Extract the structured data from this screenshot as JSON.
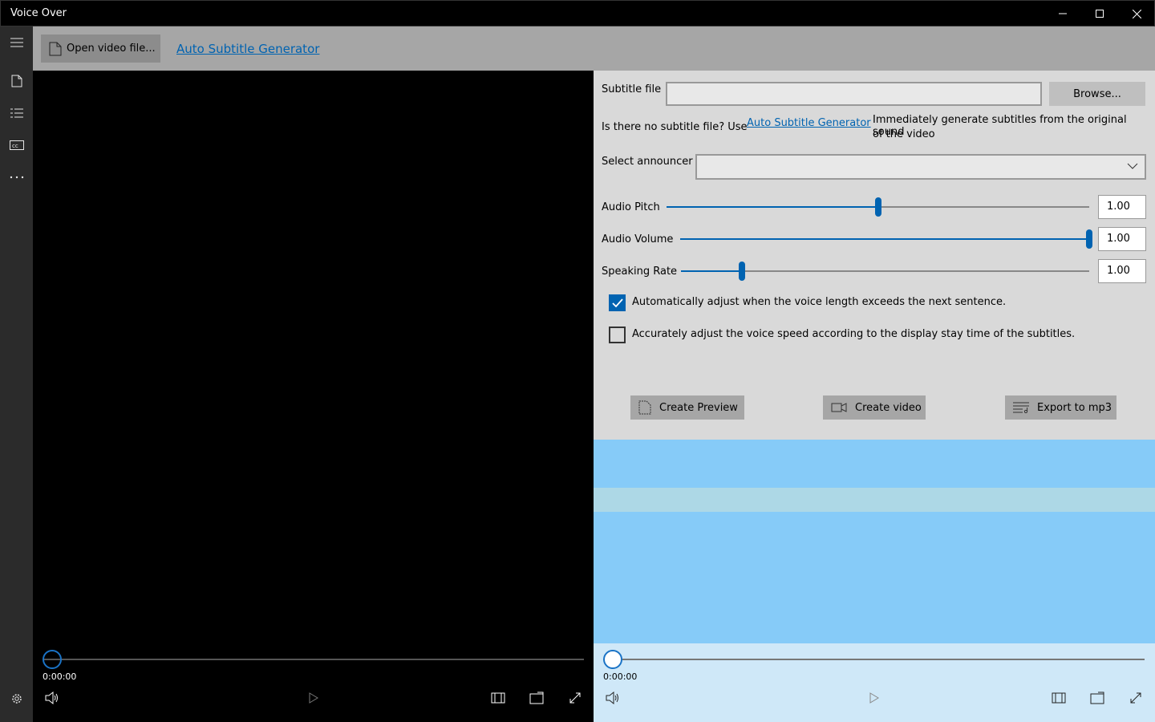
{
  "window": {
    "title": "Voice Over"
  },
  "toolbar": {
    "open_video_label": "Open video file...",
    "auto_subtitle_link": "Auto Subtitle Generator"
  },
  "nav": {
    "icons": [
      "hamburger-icon",
      "document-icon",
      "list-icon",
      "closed-caption-icon",
      "more-icon",
      "gear-icon"
    ]
  },
  "left_player": {
    "time": "0:00:00",
    "progress": 0
  },
  "form": {
    "subtitle_file_label": "Subtitle file",
    "subtitle_file_value": "",
    "browse_label": "Browse...",
    "no_subtitle_prompt": "Is there no subtitle file? Use",
    "auto_subtitle_link": "Auto Subtitle Generator",
    "auto_subtitle_desc_line1": "Immediately generate subtitles from the original sound",
    "auto_subtitle_desc_line2": "of the video",
    "announcer_label": "Select announcer",
    "announcer_value": "",
    "pitch_label": "Audio Pitch",
    "pitch_value": "1.00",
    "volume_label": "Audio Volume",
    "volume_value": "1.00",
    "rate_label": "Speaking Rate",
    "rate_value": "1.00",
    "auto_adjust_label": "Automatically adjust when the voice length exceeds the next sentence.",
    "auto_adjust_checked": true,
    "accurate_adjust_label": "Accurately adjust the voice speed according to the display stay time of the subtitles.",
    "accurate_adjust_checked": false
  },
  "sliders": {
    "pitch_fraction": 0.5,
    "volume_fraction": 1.0,
    "rate_fraction": 0.15
  },
  "actions": {
    "create_preview_label": "Create Preview",
    "create_video_label": "Create video",
    "export_mp3_label": "Export to mp3"
  },
  "right_player": {
    "time": "0:00:00",
    "progress": 0
  },
  "colors": {
    "accent": "#0063b1",
    "preview_bg": "#86cbf8",
    "preview_band": "#add8e6",
    "player_bg": "#cfe8f8"
  }
}
